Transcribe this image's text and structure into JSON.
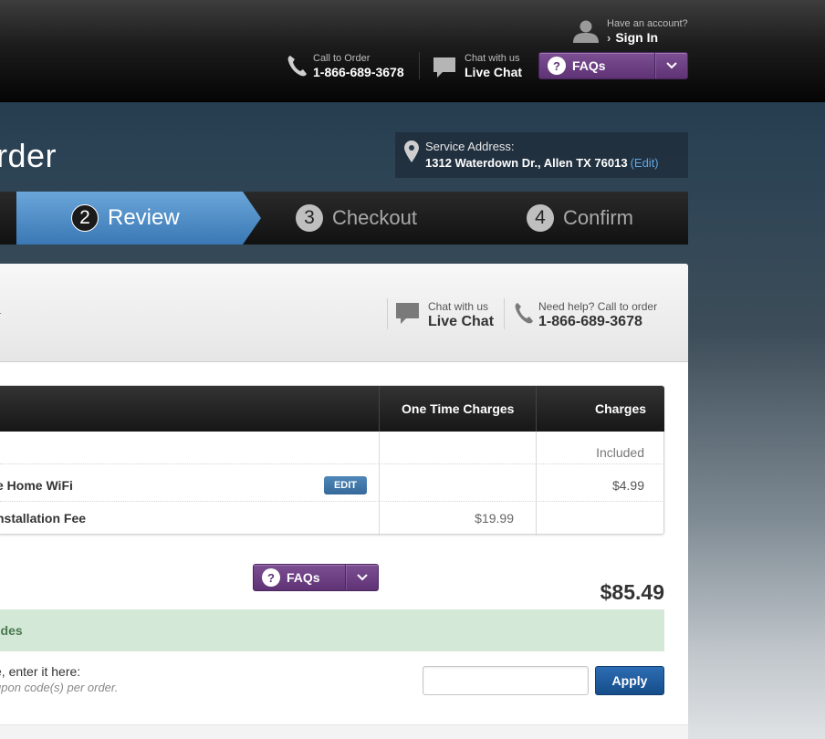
{
  "header": {
    "account_prompt": "Have an account?",
    "sign_in": "Sign In",
    "call_label": "Call to Order",
    "call_number": "1-866-689-3678",
    "chat_label": "Chat with us",
    "chat_action": "Live Chat",
    "faqs": "FAQs"
  },
  "hero": {
    "title_fragment": "rder",
    "service_label": "Service Address:",
    "service_address": "1312 Waterdown Dr., Allen TX 76013",
    "service_edit": "(Edit)"
  },
  "steps": [
    {
      "number": "2",
      "label": "Review",
      "active": true
    },
    {
      "number": "3",
      "label": "Checkout",
      "active": false
    },
    {
      "number": "4",
      "label": "Confirm",
      "active": false
    }
  ],
  "panel": {
    "faqs": "FAQs",
    "chat_label": "Chat with us",
    "chat_action": "Live Chat",
    "help_label": "Need help? Call to order",
    "help_number": "1-866-689-3678"
  },
  "table": {
    "headers": {
      "one_time": "One Time Charges",
      "charges": "Charges"
    },
    "rows": [
      {
        "item": "",
        "one_time": "",
        "charges": "Included"
      },
      {
        "item": "e Home WiFi",
        "edit": "EDIT",
        "one_time": "",
        "charges": "$4.99"
      },
      {
        "item": "nstallation Fee",
        "one_time": "$19.99",
        "charges": ""
      }
    ]
  },
  "total": "$85.49",
  "promo": {
    "bar_text": "odes",
    "line1": "e, enter it here:",
    "line2": "upon code(s) per order.",
    "input_value": "",
    "apply": "Apply"
  },
  "colors": {
    "accent_blue": "#3a78b5",
    "faq_purple": "#6a3f80",
    "promo_green": "#d4e8d7",
    "apply_blue": "#1d5a9c"
  },
  "icons": [
    "user-icon",
    "phone-icon",
    "chat-bubble-icon",
    "question-icon",
    "chevron-down-icon",
    "location-pin-icon"
  ]
}
